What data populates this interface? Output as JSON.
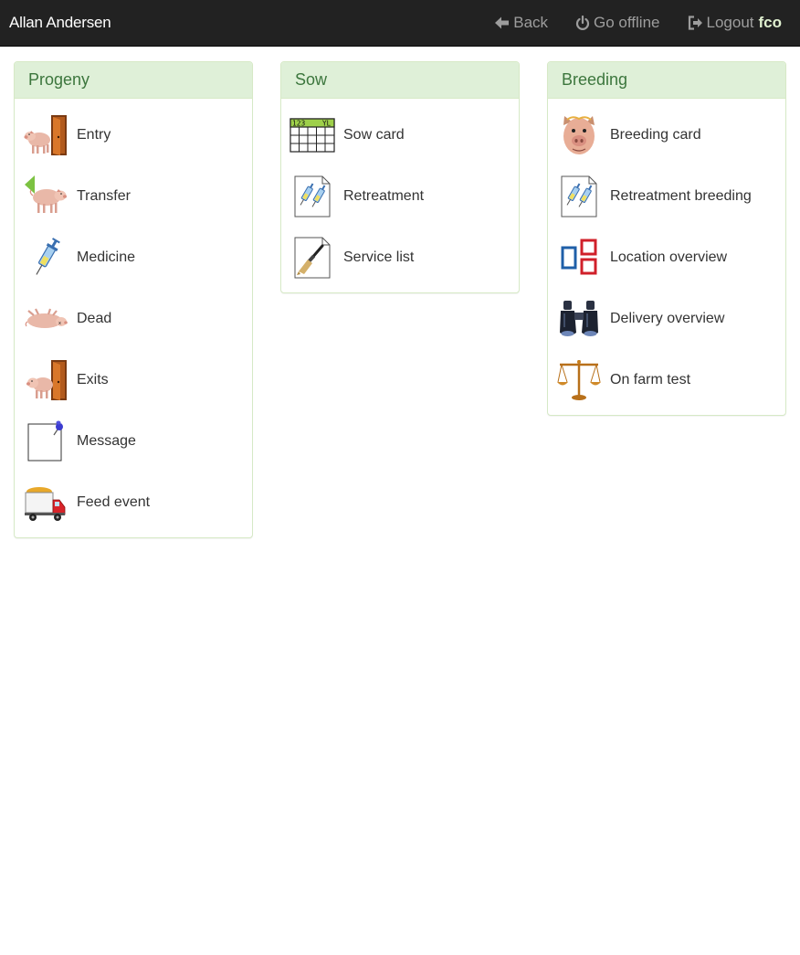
{
  "navbar": {
    "brand": "Allan Andersen",
    "back_label": "Back",
    "offline_label": "Go offline",
    "logout_label": "Logout",
    "username": "fco"
  },
  "panels": {
    "progeny": {
      "title": "Progeny",
      "items": [
        {
          "label": "Entry",
          "icon": "pig-door-icon"
        },
        {
          "label": "Transfer",
          "icon": "pig-arrow-icon"
        },
        {
          "label": "Medicine",
          "icon": "syringe-icon"
        },
        {
          "label": "Dead",
          "icon": "dead-pig-icon"
        },
        {
          "label": "Exits",
          "icon": "pig-door-icon"
        },
        {
          "label": "Message",
          "icon": "note-pin-icon"
        },
        {
          "label": "Feed event",
          "icon": "feed-truck-icon"
        }
      ]
    },
    "sow": {
      "title": "Sow",
      "items": [
        {
          "label": "Sow card",
          "icon": "calendar-card-icon"
        },
        {
          "label": "Retreatment",
          "icon": "syringe-document-icon"
        },
        {
          "label": "Service list",
          "icon": "brush-document-icon"
        }
      ]
    },
    "breeding": {
      "title": "Breeding",
      "items": [
        {
          "label": "Breeding card",
          "icon": "pig-face-icon"
        },
        {
          "label": "Retreatment breeding",
          "icon": "syringe-document-icon"
        },
        {
          "label": "Location overview",
          "icon": "location-boxes-icon"
        },
        {
          "label": "Delivery overview",
          "icon": "binoculars-icon"
        },
        {
          "label": "On farm test",
          "icon": "scales-icon"
        }
      ]
    }
  },
  "colors": {
    "navbar_bg": "#222222",
    "panel_heading_bg": "#dff0d8",
    "panel_heading_text": "#3c763d",
    "panel_border": "#d6e9c6"
  }
}
